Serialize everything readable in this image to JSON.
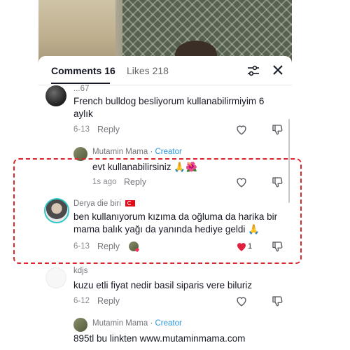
{
  "tabs": {
    "comments_label": "Comments 16",
    "likes_label": "Likes 218"
  },
  "icons": {
    "filter": "filter-sliders-icon",
    "close": "close-icon",
    "heart": "heart-icon",
    "dislike": "thumbs-down-icon",
    "pray": "folded-hands-emoji",
    "flower": "hibiscus-emoji",
    "flag": "turkey-flag-emoji"
  },
  "colors": {
    "creator": "#2b95d6",
    "highlight": "#d9262b",
    "liked": "#fe2c55"
  },
  "comments": [
    {
      "username": "...67",
      "text_line1": "French bulldog besliyorum kullanabilirmiyim 6",
      "text_line2": "aylık",
      "date": "6-13",
      "reply": "Reply"
    },
    {
      "username": "Mutamin Mama",
      "separator": " · ",
      "badge": "Creator",
      "text": "evt kullanabilirsiniz",
      "date": "1s ago",
      "reply": "Reply"
    },
    {
      "username": "Derya  die  biri",
      "text_line1": "ben kullanıyorum kızıma da oğluma da harika bir",
      "text_line2": "mama balık yağı da yanında hediye geldi",
      "date": "6-13",
      "reply": "Reply",
      "likes": "1"
    },
    {
      "username": "kdjs",
      "text": "kuzu etli fiyat nedir basil siparis vere biluriz",
      "date": "6-12",
      "reply": "Reply"
    },
    {
      "username": "Mutamin Mama",
      "separator": " · ",
      "badge": "Creator",
      "text": "895tl bu linkten www.mutaminmama.com"
    }
  ]
}
